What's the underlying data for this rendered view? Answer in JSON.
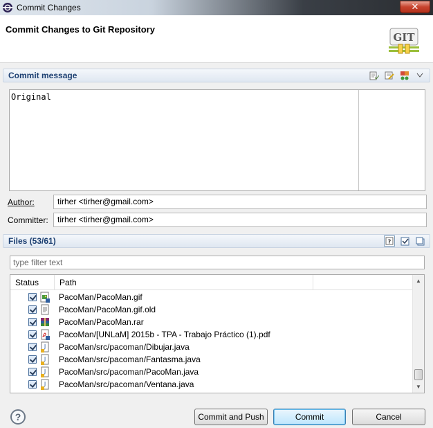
{
  "window": {
    "title": "Commit Changes",
    "close_label": "✕"
  },
  "header": {
    "heading": "Commit Changes to Git Repository",
    "logo_text": "GIT"
  },
  "commit_message": {
    "section_label": "Commit message",
    "text": "Original"
  },
  "author": {
    "label": "Author:",
    "value": "tirher <tirher@gmail.com>"
  },
  "committer": {
    "label": "Committer:",
    "value": "tirher <tirher@gmail.com>"
  },
  "files": {
    "section_label": "Files (53/61)",
    "filter_placeholder": "type filter text",
    "columns": {
      "status": "Status",
      "path": "Path"
    },
    "rows": [
      {
        "path": "PacoMan/PacoMan.gif",
        "icon": "image-file-icon",
        "checked": true
      },
      {
        "path": "PacoMan/PacoMan.gif.old",
        "icon": "text-file-icon",
        "checked": true
      },
      {
        "path": "PacoMan/PacoMan.rar",
        "icon": "archive-file-icon",
        "checked": true
      },
      {
        "path": "PacoMan/[UNLaM] 2015b - TPA - Trabajo Práctico (1).pdf",
        "icon": "pdf-file-icon",
        "checked": true
      },
      {
        "path": "PacoMan/src/pacoman/Dibujar.java",
        "icon": "java-file-icon",
        "checked": true
      },
      {
        "path": "PacoMan/src/pacoman/Fantasma.java",
        "icon": "java-file-icon",
        "checked": true
      },
      {
        "path": "PacoMan/src/pacoman/PacoMan.java",
        "icon": "java-file-icon",
        "checked": true
      },
      {
        "path": "PacoMan/src/pacoman/Ventana.java",
        "icon": "java-file-icon",
        "checked": true
      }
    ]
  },
  "buttons": {
    "help": "?",
    "commit_and_push": "Commit and Push",
    "commit": "Commit",
    "cancel": "Cancel"
  },
  "colors": {
    "section_text": "#1c3f71",
    "section_bg": "#dfe7f1",
    "default_button": "#bee6fd"
  }
}
